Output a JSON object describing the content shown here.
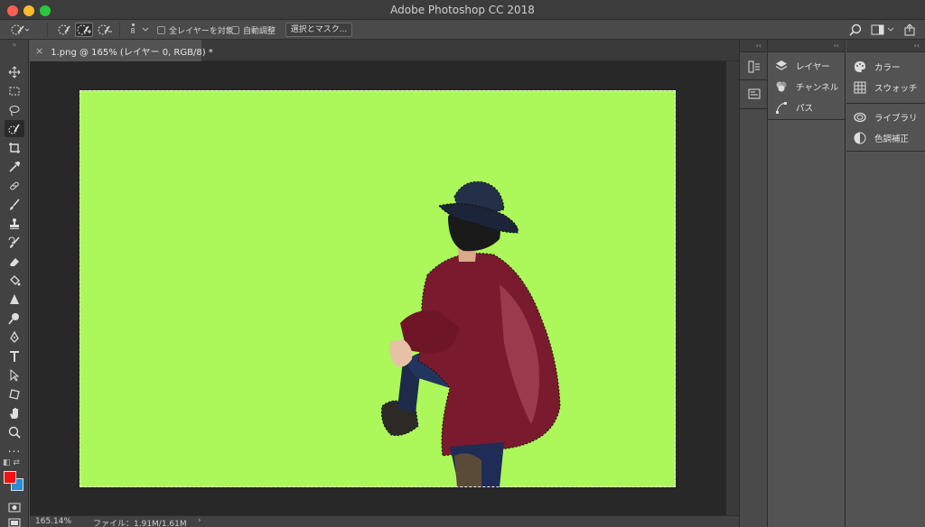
{
  "window": {
    "title": "Adobe Photoshop CC 2018"
  },
  "options_bar": {
    "brush_size": "8",
    "sample_all_layers_label": "全レイヤーを対象",
    "auto_enhance_label": "自動調整",
    "select_and_mask_label": "選択とマスク..."
  },
  "document": {
    "tab_title": "1.png @ 165% (レイヤー 0, RGB/8) *",
    "tab_close": "×",
    "canvas_background_color": "#acf85a"
  },
  "status_bar": {
    "zoom": "165.14%",
    "file_info": "ファイル：1.91M/1.61M",
    "arrow": "›"
  },
  "colors": {
    "foreground": "#f21212",
    "background": "#2a8cd4"
  },
  "panels": {
    "mid": [
      {
        "label": "レイヤー",
        "icon": "layers-icon"
      },
      {
        "label": "チャンネル",
        "icon": "channels-icon"
      },
      {
        "label": "パス",
        "icon": "paths-icon"
      }
    ],
    "right": [
      {
        "label": "カラー",
        "icon": "color-palette-icon"
      },
      {
        "label": "スウォッチ",
        "icon": "swatches-icon"
      },
      {
        "label": "ライブラリ",
        "icon": "libraries-icon"
      },
      {
        "label": "色調補正",
        "icon": "adjustments-icon"
      }
    ]
  },
  "toolbar": {
    "collapse": "»",
    "more_tools": "...",
    "tools": [
      "move-tool-icon",
      "marquee-tool-icon",
      "lasso-tool-icon",
      "quick-selection-tool-icon",
      "crop-tool-icon",
      "eyedropper-tool-icon",
      "healing-brush-icon",
      "brush-tool-icon",
      "clone-stamp-icon",
      "history-brush-icon",
      "eraser-tool-icon",
      "paint-bucket-icon",
      "sharpen-tool-icon",
      "dodge-tool-icon",
      "pen-tool-icon",
      "type-tool-icon",
      "path-selection-icon",
      "shape-tool-icon",
      "hand-tool-icon",
      "zoom-tool-icon"
    ]
  }
}
